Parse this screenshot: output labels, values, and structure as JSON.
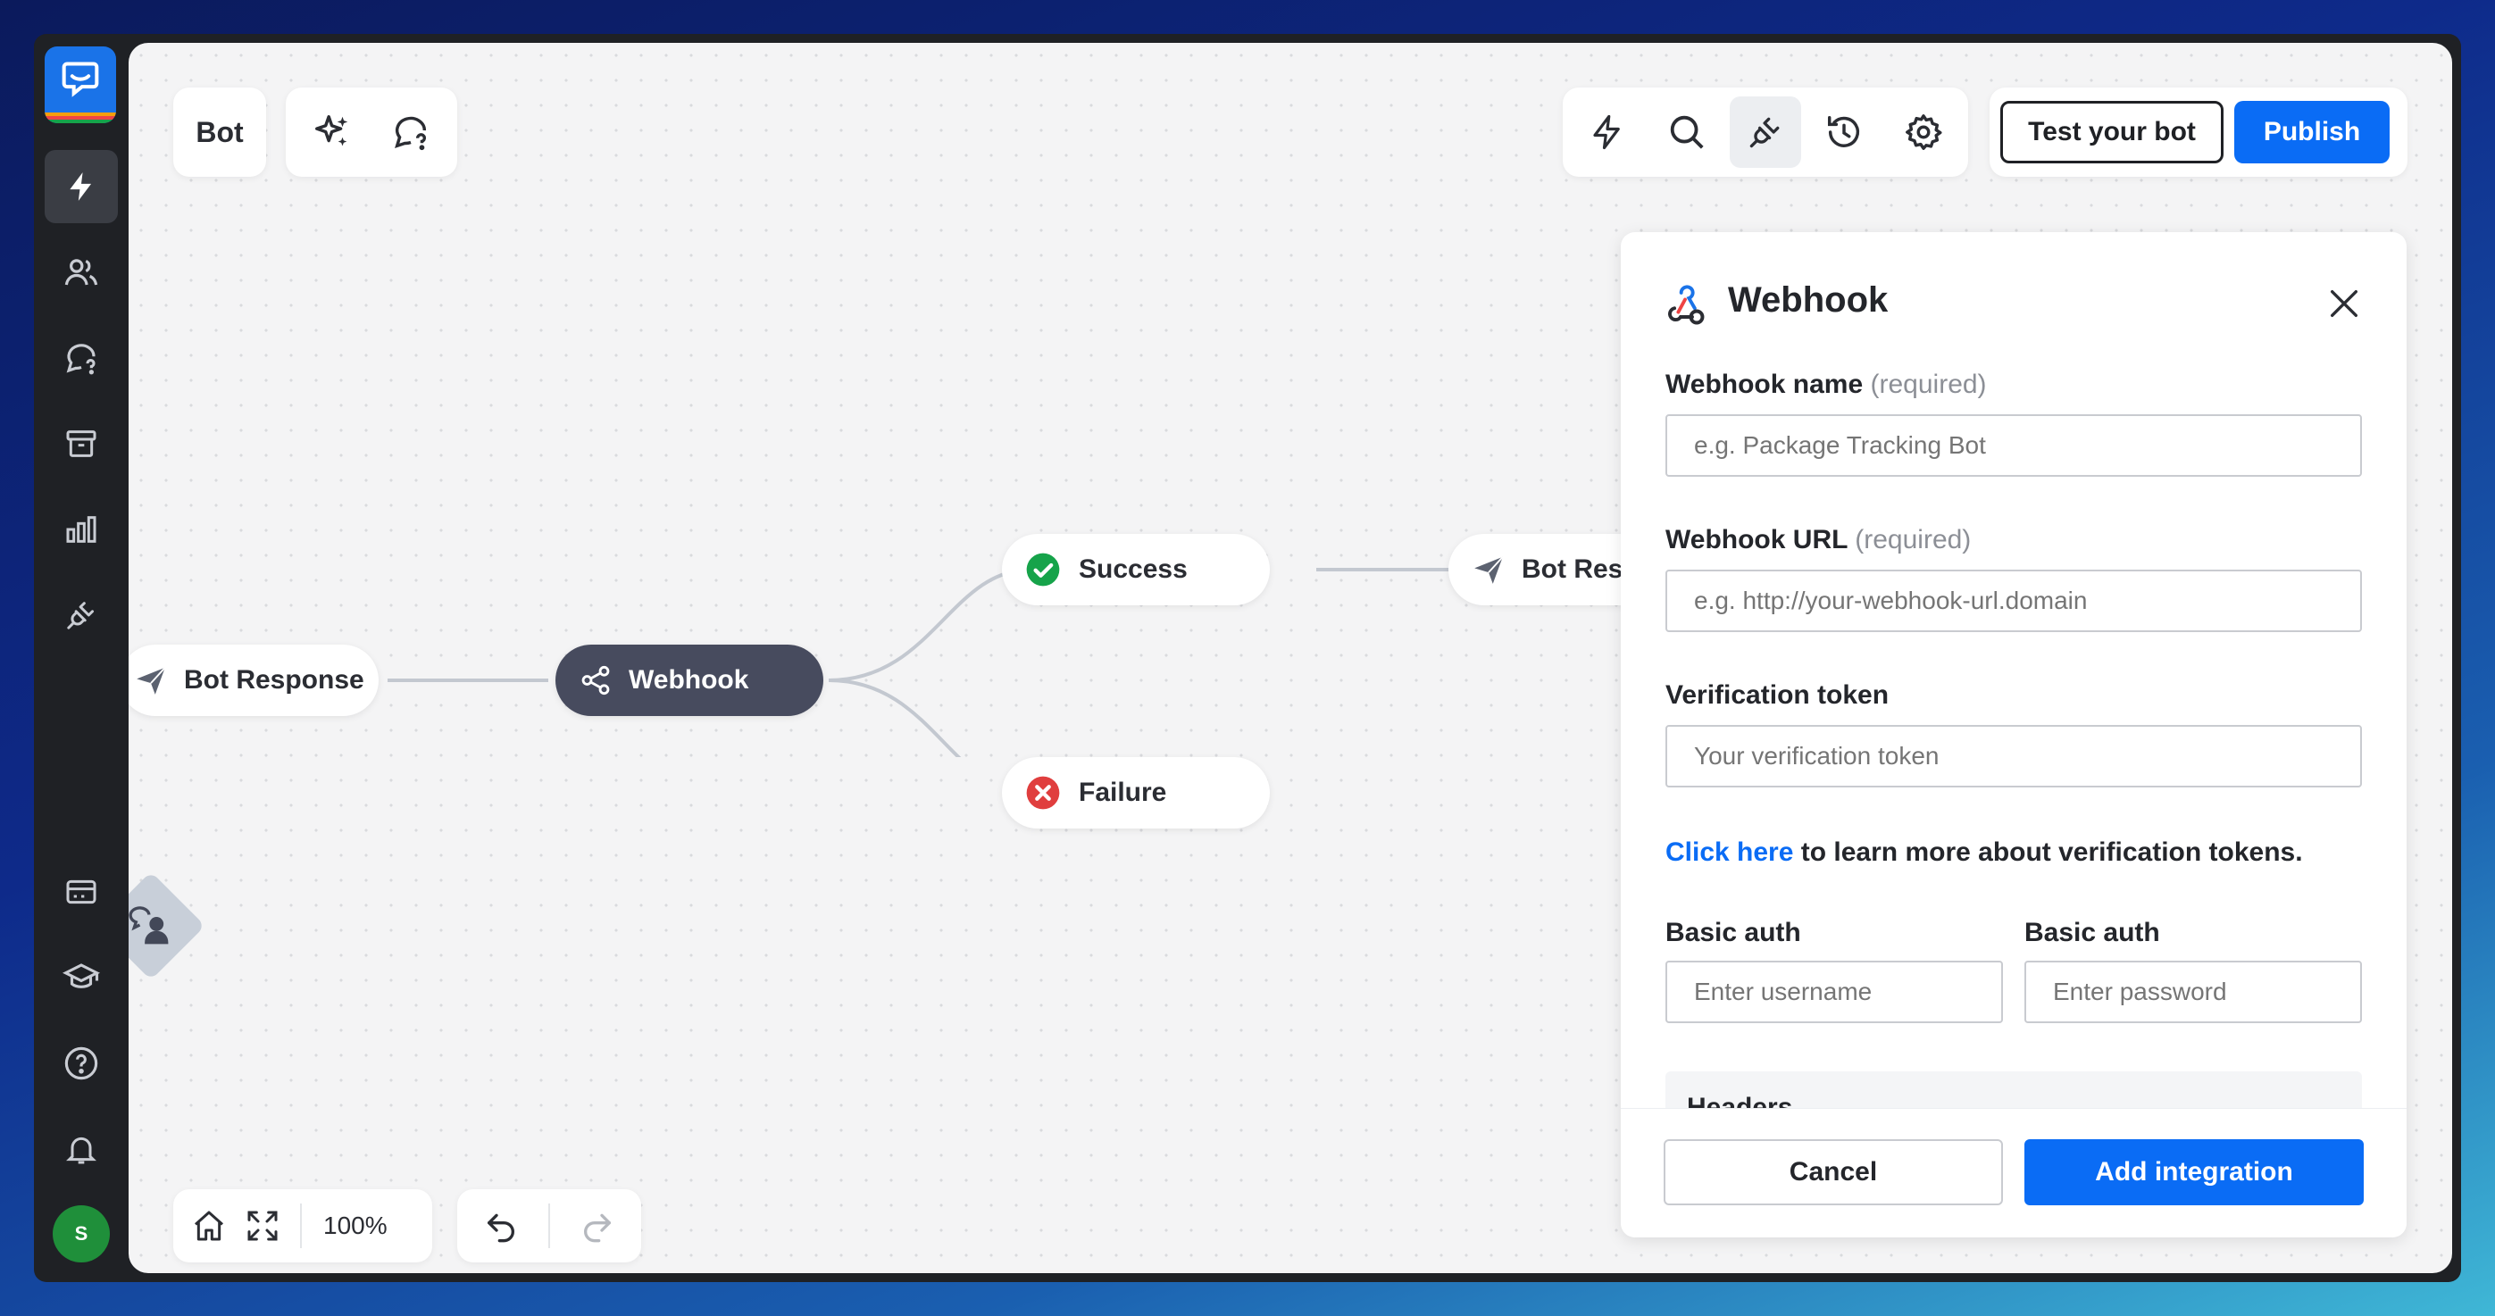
{
  "sidebar": {
    "avatar_initial": "S",
    "items_top": [
      "automations-icon",
      "users-icon",
      "chat-question-icon",
      "archive-icon",
      "reports-icon",
      "integrations-icon"
    ],
    "items_bottom": [
      "billing-icon",
      "academy-icon",
      "help-icon",
      "notifications-icon"
    ]
  },
  "toolbar": {
    "bot_label": "Bot",
    "test_label": "Test your bot",
    "publish_label": "Publish"
  },
  "flow": {
    "nodes": {
      "bot_response_left": "Bot Response",
      "webhook": "Webhook",
      "success": "Success",
      "failure": "Failure",
      "bot_response_right": "Bot Res"
    }
  },
  "bottom_bar": {
    "zoom": "100%"
  },
  "panel": {
    "title": "Webhook",
    "webhook_name_label": "Webhook name",
    "webhook_url_label": "Webhook URL",
    "required_text": "(required)",
    "webhook_name_placeholder": "e.g. Package Tracking Bot",
    "webhook_url_placeholder": "e.g. http://your-webhook-url.domain",
    "token_label": "Verification token",
    "token_placeholder": "Your verification token",
    "help_link": "Click here",
    "help_text": " to learn more about verification tokens.",
    "basic_auth_label_1": "Basic auth",
    "basic_auth_label_2": "Basic auth",
    "username_placeholder": "Enter username",
    "password_placeholder": "Enter password",
    "headers_label": "Headers",
    "cancel_label": "Cancel",
    "add_label": "Add integration"
  },
  "colors": {
    "accent": "#0a6cf5",
    "success": "#16a34a",
    "failure": "#e03e3e",
    "node_dark": "#474b5e"
  }
}
